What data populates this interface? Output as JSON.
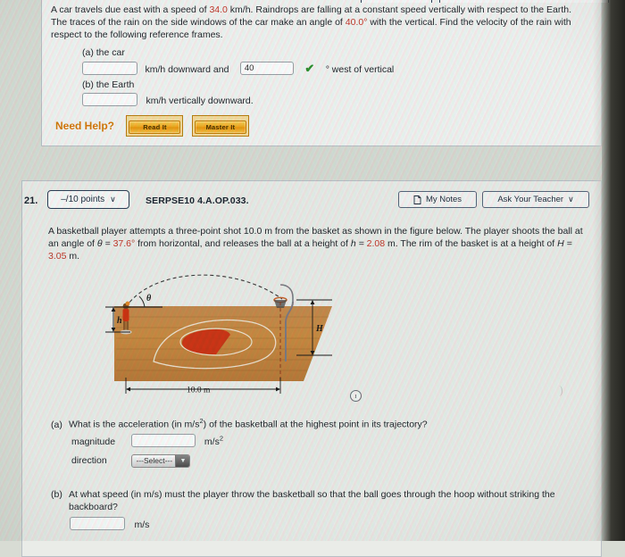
{
  "q20": {
    "text_line1_a": "A car travels due east with a speed of ",
    "speed": "34.0",
    "text_line1_b": " km/h. Raindrops are falling at a constant speed vertically with respect to the Earth. The traces of the rain on the side windows of the car make an angle of ",
    "angle": "40.0°",
    "text_line1_c": " with the vertical. Find the velocity of the rain with respect to the following reference frames.",
    "part_a_label": "(a) the car",
    "part_a_unit": "km/h downward and",
    "part_a_answer": "40",
    "part_a_suffix": "° west of vertical",
    "part_b_label": "(b) the Earth",
    "part_b_unit": "km/h vertically downward.",
    "part_a_value": "",
    "part_b_value": "",
    "need_help": "Need Help?",
    "read_it": "Read It",
    "master_it": "Master It"
  },
  "q21": {
    "number": "21.",
    "points": "–/10 points",
    "points_chevron": "∨",
    "code": "SERPSE10 4.A.OP.033.",
    "my_notes": "My Notes",
    "notes_icon": "note-page-icon",
    "ask_teacher": "Ask Your Teacher",
    "ask_chevron": "∨",
    "text_a": "A basketball player attempts a three-point shot 10.0 m from the basket as shown in the figure below. The player shoots the ball at an angle of ",
    "theta_eq": "θ = ",
    "theta_val": "37.6°",
    "text_b": " from horizontal, and releases the ball at a height of ",
    "h_eq": "h = ",
    "h_val": "2.08",
    "text_c": " m. The rim of the basket is at a height of ",
    "H_eq": "H = ",
    "H_val": "3.05",
    "text_d": " m.",
    "figure": {
      "theta_label": "θ",
      "h_label": "h",
      "H_label": "H",
      "distance_label": "10.0 m",
      "info_icon": "ı"
    },
    "part_a": {
      "label": "(a)",
      "question_pre": "What is the acceleration (in m/s",
      "question_sup": "2",
      "question_post": ") of the basketball at the highest point in its trajectory?",
      "magnitude_label": "magnitude",
      "magnitude_value": "",
      "magnitude_unit_pre": "m/s",
      "magnitude_unit_sup": "2",
      "direction_label": "direction",
      "direction_value": "---Select---",
      "direction_arrow": "▼"
    },
    "part_b": {
      "label": "(b)",
      "question": "At what speed (in m/s) must the player throw the basketball so that the ball goes through the hoop without striking the backboard?",
      "value": "",
      "unit": "m/s"
    }
  },
  "colors": {
    "accent_value": "#c0392b",
    "check_green": "#2f8f2f",
    "help_orange": "#d4780a",
    "button_border": "#2c3e55"
  }
}
